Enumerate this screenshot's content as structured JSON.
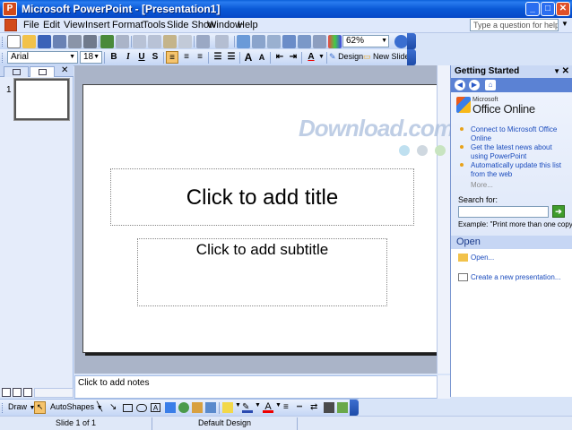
{
  "window": {
    "title": "Microsoft PowerPoint - [Presentation1]",
    "controls": {
      "minimize": "_",
      "maximize": "□",
      "close": "✕"
    }
  },
  "menu": {
    "items": [
      "File",
      "Edit",
      "View",
      "Insert",
      "Format",
      "Tools",
      "Slide Show",
      "Window",
      "Help"
    ],
    "help_placeholder": "Type a question for help"
  },
  "standard_toolbar": {
    "zoom": "62%"
  },
  "format_toolbar": {
    "font": "Arial",
    "size": "18",
    "bold": "B",
    "italic": "I",
    "underline": "U",
    "shadow": "S",
    "design_label": "Design",
    "new_slide_label": "New Slide",
    "font_grow": "A",
    "font_shrink": "A",
    "font_color": "A"
  },
  "slides_pane": {
    "slide_number": "1",
    "close": "✕"
  },
  "slide": {
    "title_placeholder": "Click to add title",
    "subtitle_placeholder": "Click to add subtitle"
  },
  "notes": {
    "placeholder": "Click to add notes"
  },
  "task_pane": {
    "title": "Getting Started",
    "close": "✕",
    "brand_small": "Microsoft",
    "brand": "Office Online",
    "links": [
      "Connect to Microsoft Office Online",
      "Get the latest news about using PowerPoint",
      "Automatically update this list from the web"
    ],
    "more": "More...",
    "search_label": "Search for:",
    "search_go": "➔",
    "example": "Example:  \"Print more than one copy\"",
    "open_heading": "Open",
    "open_items": [
      "Open...",
      "Create a new presentation..."
    ]
  },
  "draw_toolbar": {
    "draw_label": "Draw",
    "autoshapes_label": "AutoShapes",
    "font_color": "A"
  },
  "status": {
    "slide": "Slide 1 of 1",
    "design": "Default Design"
  },
  "watermark": {
    "text": "Download.com.vn"
  },
  "colors": {
    "titlebar": "#0a59d6",
    "toolbar": "#c4d6f5",
    "task_pane_nav": "#5b82d4",
    "link": "#1a4bbd"
  }
}
